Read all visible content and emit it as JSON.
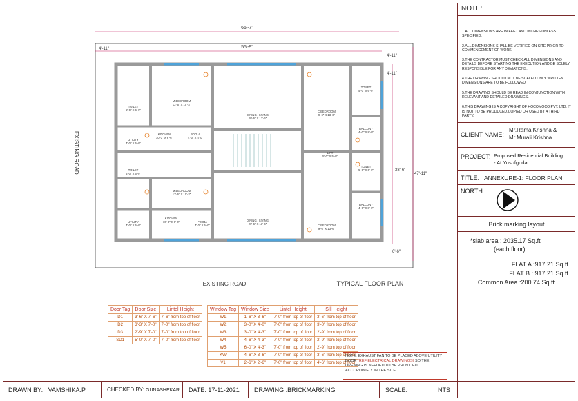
{
  "notes": {
    "header": "NOTE:",
    "items": [
      "1.ALL DIMENSIONS ARE IN FEET AND INCHES UNLESS SPECIFIED.",
      "2.ALL DIMENSIONS SHALL BE VERIFIED ON SITE PRIOR TO COMMENCEMENT OF WORK.",
      "3.THE CONTRACTOR MUST CHECK ALL DIMENSIONS AND DETAILS BEFORE STARTING THE EXECUTION AND BE SOLELY RESPONSIBLE FOR ANY DEVIATIONS.",
      "4.THE DRAWING SHOULD NOT BE SCALED.ONLY WRITTEN DIMENSIONS ARE TO BE FOLLOWED.",
      "5.THE DRAWING SHOULD BE READ IN CONJUNCTION WITH RELEVANT AND DETAILED DRAWINGS.",
      "6.THIS DRAWING IS A COPYRIGHT OF HOCOMOCO PVT. LTD. IT IS NOT TO BE PRODUCED,COPIED OR USED BY A THIRD PARTY."
    ]
  },
  "client": {
    "label": "CLIENT NAME:",
    "value_line1": "Mr.Rama Krishna &",
    "value_line2": "Mr.Murali Krishna"
  },
  "project": {
    "label": "PROJECT:",
    "value_line1": "Proposed Residential Building",
    "value_line2": "- At Yusufguda"
  },
  "title": {
    "label": "TITLE:",
    "value": "ANNEXURE-1: FLOOR PLAN"
  },
  "north": {
    "label": "NORTH:"
  },
  "layout_title": "Brick marking layout",
  "areas": {
    "slab_line1": "*slab area : 2035.17 Sq.ft",
    "slab_line2": "(each floor)",
    "flat_a": "FLAT A :917.21 Sq.ft",
    "flat_b": "FLAT B : 917.21 Sq.ft",
    "common": "Common Area :200.74 Sq.ft"
  },
  "title_block": {
    "drawn_by_label": "DRAWN BY:",
    "drawn_by": "VAMSHIKA.P",
    "checked_by_label": "CHECKED BY:",
    "checked_by": "GUNASHEKAR",
    "date_label": "DATE:",
    "date": "17-11-2021",
    "drawing_label": "DRAWING :",
    "drawing": "BRICKMARKING",
    "scale_label": "SCALE:",
    "scale": "NTS"
  },
  "plan": {
    "road_left": "EXISTING ROAD",
    "road_bottom": "EXISTING ROAD",
    "typical": "TYPICAL FLOOR PLAN",
    "dim_top_outer": "65'-7\"",
    "dim_top_inner": "55'-9\"",
    "dim_left": "4'-11\"",
    "dim_right_1": "4'-11\"",
    "dim_right_2": "38'-6\"",
    "dim_right_3": "47'-11\"",
    "dim_right_4": "6'-6\"",
    "dim_right_5": "4'-11\"",
    "rooms": {
      "m_bed_1": "M.BEDROOM",
      "m_bed_1_size": "13'-6\" X 10'-3\"",
      "dining_1": "DINING / LIVING",
      "dining_1_size": "20'-6\" X 13'-6\"",
      "c_bed_1": "C.BEDROOM",
      "c_bed_1_size": "9'-6\" X 13'-6\"",
      "kitchen_1": "KITCHEN",
      "kitchen_1_size": "10'-3\" X 6'-6\"",
      "pooja_1": "POOJA",
      "pooja_1_size": "4'-0\" X 5'-0\"",
      "utility_1": "UTILITY",
      "utility_1_size": "4'-0\" X 5'-0\"",
      "toilet_1": "TOILET",
      "toilet_1_size": "5'-0\" X 6'-0\"",
      "toilet_2": "TOILET",
      "toilet_2_size": "5'-0\" X 6'-0\"",
      "balcony_1": "BALCONY",
      "balcony_1_size": "4'-0\" X 8'-0\"",
      "lift": "LIFT",
      "lift_size": "5'-0\" X 5'-0\"",
      "m_bed_2": "M.BEDROOM",
      "m_bed_2_size": "13'-6\" X 10'-3\"",
      "dining_2": "DINING / LIVING",
      "dining_2_size": "20'-6\" X 13'-6\"",
      "c_bed_2": "C.BEDROOM",
      "c_bed_2_size": "9'-6\" X 13'-6\"",
      "kitchen_2": "KITCHEN",
      "kitchen_2_size": "10'-3\" X 6'-6\"",
      "pooja_2": "POOJA",
      "pooja_2_size": "4'-0\" X 5'-0\"",
      "utility_2": "UTILITY",
      "utility_2_size": "4'-0\" X 5'-0\"",
      "toilet_3": "TOILET",
      "toilet_3_size": "5'-0\" X 6'-0\"",
      "toilet_4": "TOILET",
      "toilet_4_size": "5'-0\" X 6'-0\"",
      "balcony_2": "BALCONY",
      "balcony_2_size": "4'-0\" X 8'-0\""
    }
  },
  "door_schedule": {
    "headers": [
      "Door Tag",
      "Door Size",
      "Lintel Height"
    ],
    "lintel_suffix": "from top of floor",
    "rows": [
      [
        "D1",
        "3'-6\" X 7'-6\"",
        "7'-6\""
      ],
      [
        "D2",
        "3'-3\" X 7'-0\"",
        "7'-0\""
      ],
      [
        "D3",
        "2'-9\" X 7'-0\"",
        "7'-0\""
      ],
      [
        "SD1",
        "5'-0\" X 7'-0\"",
        "7'-0\""
      ]
    ]
  },
  "window_schedule": {
    "headers": [
      "Window Tag",
      "Window Size",
      "Lintel Height",
      "Sill Height"
    ],
    "suffix": "from top of floor",
    "rows": [
      [
        "W1",
        "1'-6\" X 3'-6\"",
        "7'-0\"",
        "3'-6\""
      ],
      [
        "W2",
        "3'-0\" X 4'-0\"",
        "7'-0\"",
        "3'-0\""
      ],
      [
        "W3",
        "3'-0\" X 4'-3\"",
        "7'-0\"",
        "2'-9\""
      ],
      [
        "W4",
        "4'-6\" X 4'-3\"",
        "7'-0\"",
        "2'-9\""
      ],
      [
        "W5",
        "6'-0\" X 4'-3\"",
        "7'-0\"",
        "2'-9\""
      ],
      [
        "KW",
        "4'-6\" X 3'-6\"",
        "7'-0\"",
        "3'-6\""
      ],
      [
        "V1",
        "2'-6\" X 2'-6\"",
        "7'-0\"",
        "4'-6\""
      ]
    ]
  },
  "exhaust_note": {
    "prefix": "NOTE: EXHAUST FAN TO BE PLACED ABOVE UTILITY DOOR ",
    "ref": "(REF ELECTRICAL DRAWINGS)",
    "suffix": " SO THE OPENING IS NEEDED TO BE PROVIDED ACCORDINGLY IN THE SITE"
  },
  "colors": {
    "border": "#7a2a2a",
    "wall": "#9a9a9a",
    "dim": "#c2185b",
    "accent": "#e67e22",
    "window": "#4fa3d9"
  }
}
